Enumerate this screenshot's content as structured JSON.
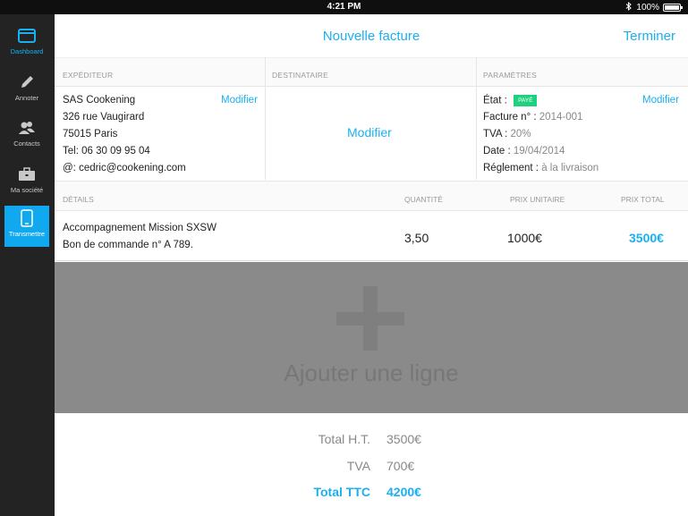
{
  "status_bar": {
    "time": "4:21 PM",
    "battery": "100%"
  },
  "sidebar": {
    "items": [
      {
        "label": "Dashboard",
        "icon": "dashboard-icon"
      },
      {
        "label": "Annoter",
        "icon": "pencil-icon"
      },
      {
        "label": "Contacts",
        "icon": "contacts-icon"
      },
      {
        "label": "Ma société",
        "icon": "briefcase-icon"
      },
      {
        "label": "Transmettre",
        "icon": "tablet-icon"
      }
    ]
  },
  "header": {
    "title": "Nouvelle facture",
    "done": "Terminer"
  },
  "sections": {
    "sender_label": "EXPÉDITEUR",
    "recipient_label": "DESTINATAIRE",
    "params_label": "PARAMÈTRES"
  },
  "sender": {
    "name": "SAS Cookening",
    "street": "326 rue Vaugirard",
    "city": "75015 Paris",
    "tel": "Tel: 06 30 09 95 04",
    "email": "@: cedric@cookening.com",
    "edit": "Modifier"
  },
  "recipient": {
    "edit": "Modifier"
  },
  "params": {
    "state_label": "État :",
    "state_badge": "PAYÉ",
    "invoice_label": "Facture n° :",
    "invoice_value": "2014-001",
    "tva_label": "TVA :",
    "tva_value": "20%",
    "date_label": "Date :",
    "date_value": "19/04/2014",
    "payment_label": "Réglement :",
    "payment_value": "à la livraison",
    "edit": "Modifier"
  },
  "details": {
    "headers": {
      "details": "DÉTAILS",
      "quantity": "QUANTITÉ",
      "unit_price": "PRIX UNITAIRE",
      "total_price": "PRIX TOTAL"
    },
    "row": {
      "line1": "Accompagnement Mission SXSW",
      "line2": "Bon de commande n° A 789.",
      "quantity": "3,50",
      "unit_price": "1000€",
      "total": "3500€"
    }
  },
  "add_line": {
    "label": "Ajouter une ligne"
  },
  "totals": {
    "ht_label": "Total H.T.",
    "ht_value": "3500€",
    "tva_label": "TVA",
    "tva_value": "700€",
    "ttc_label": "Total TTC",
    "ttc_value": "4200€"
  },
  "colors": {
    "accent": "#1ab0f0",
    "sidebar": "#232323",
    "paid": "#1fd17f"
  }
}
